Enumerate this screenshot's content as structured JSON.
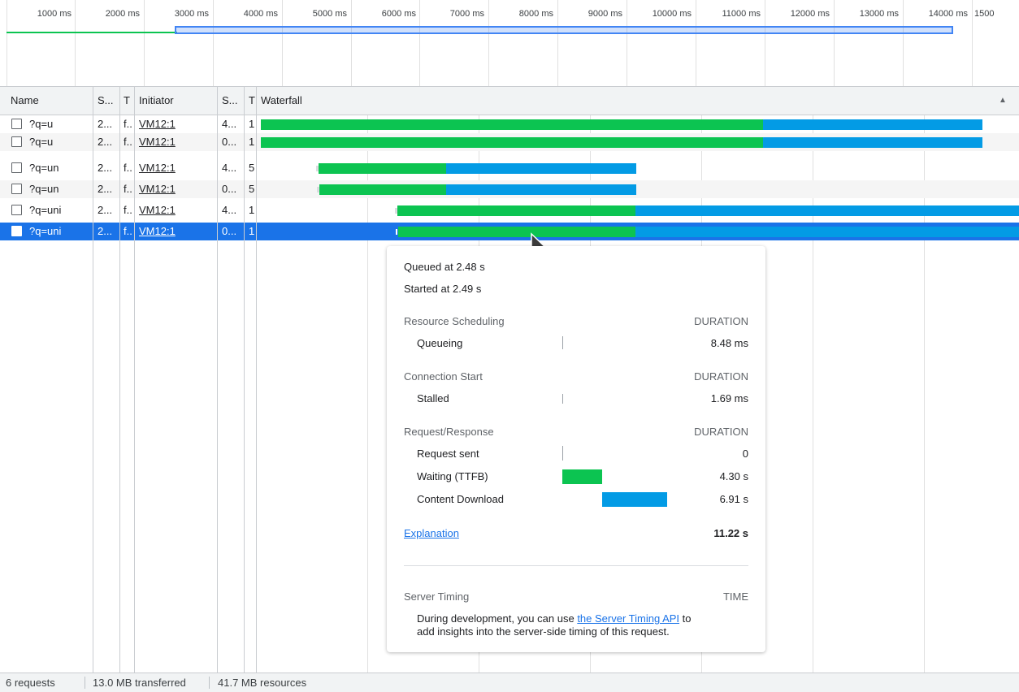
{
  "overview": {
    "tick_labels": [
      "1000 ms",
      "2000 ms",
      "3000 ms",
      "4000 ms",
      "5000 ms",
      "6000 ms",
      "7000 ms",
      "8000 ms",
      "9000 ms",
      "10000 ms",
      "11000 ms",
      "12000 ms",
      "13000 ms",
      "14000 ms",
      "1500"
    ]
  },
  "table": {
    "columns": [
      "Name",
      "S...",
      "T",
      "Initiator",
      "S...",
      "T",
      "Waterfall"
    ],
    "sort_icon": "triangle-up-icon",
    "rows": [
      {
        "name": "?q=u",
        "status": "2...",
        "type": "f...",
        "initiator": "VM12:1",
        "size": "4...",
        "time": "1"
      },
      {
        "name": "?q=u",
        "status": "2...",
        "type": "f...",
        "initiator": "VM12:1",
        "size": "0...",
        "time": "1"
      },
      {
        "name": "?q=un",
        "status": "2...",
        "type": "f...",
        "initiator": "VM12:1",
        "size": "4...",
        "time": "5"
      },
      {
        "name": "?q=un",
        "status": "2...",
        "type": "f...",
        "initiator": "VM12:1",
        "size": "0...",
        "time": "5"
      },
      {
        "name": "?q=uni",
        "status": "2...",
        "type": "f...",
        "initiator": "VM12:1",
        "size": "4...",
        "time": "1"
      },
      {
        "name": "?q=uni",
        "status": "2...",
        "type": "f...",
        "initiator": "VM12:1",
        "size": "0...",
        "time": "1"
      }
    ]
  },
  "tooltip": {
    "queued_at": "Queued at 2.48 s",
    "started_at": "Started at 2.49 s",
    "duration_header": "DURATION",
    "sections": [
      {
        "title": "Resource Scheduling",
        "items": [
          {
            "label": "Queueing",
            "value": "8.48 ms"
          }
        ]
      },
      {
        "title": "Connection Start",
        "items": [
          {
            "label": "Stalled",
            "value": "1.69 ms"
          }
        ]
      },
      {
        "title": "Request/Response",
        "items": [
          {
            "label": "Request sent",
            "value": "0"
          },
          {
            "label": "Waiting (TTFB)",
            "value": "4.30 s"
          },
          {
            "label": "Content Download",
            "value": "6.91 s"
          }
        ]
      }
    ],
    "explanation_link": "Explanation",
    "total": "11.22 s",
    "server_timing": {
      "title": "Server Timing",
      "time_header": "TIME",
      "text_before": "During development, you can use",
      "link": "the Server Timing API",
      "text_after": "to",
      "text_line2": "add insights into the server-side timing of this request."
    }
  },
  "status_bar": {
    "requests": "6 requests",
    "transferred": "13.0 MB transferred",
    "resources": "41.7 MB resources"
  },
  "colors": {
    "waiting": "#0cc451",
    "download": "#039be5",
    "selected_row": "#1a73e8"
  }
}
